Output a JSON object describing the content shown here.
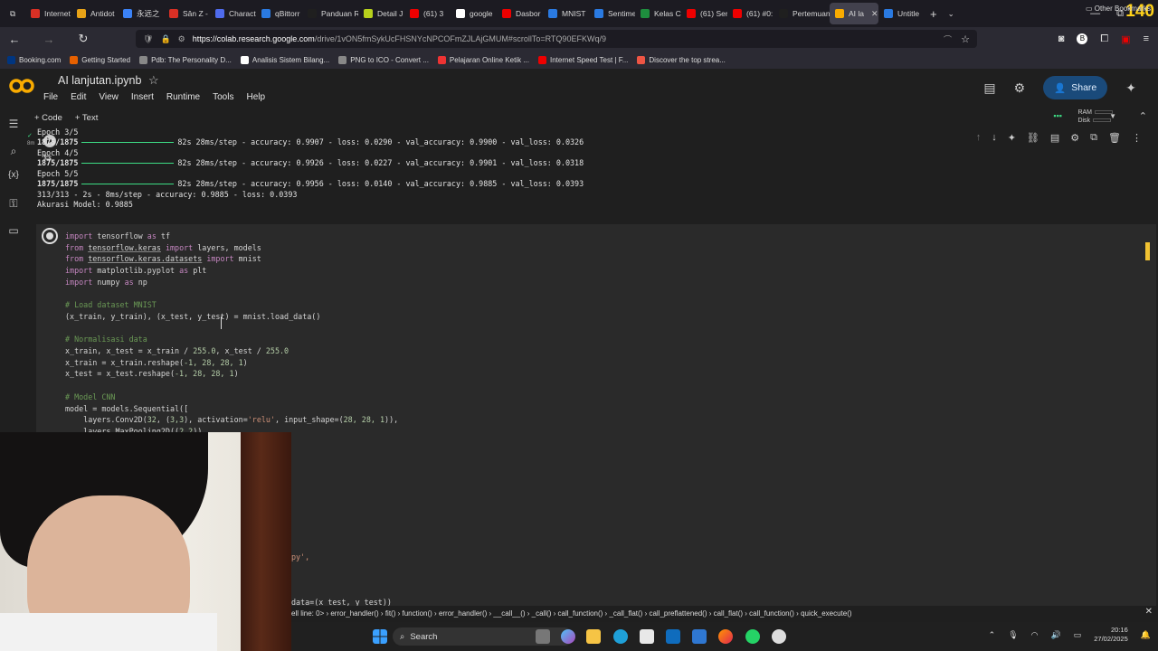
{
  "browser": {
    "tabs": [
      {
        "label": "Internet",
        "color": "#d93025"
      },
      {
        "label": "Antidot",
        "color": "#e8a317"
      },
      {
        "label": "永远之",
        "color": "#3b82f6"
      },
      {
        "label": "Sân Z -",
        "color": "#d93025"
      },
      {
        "label": "Charact",
        "color": "#4f6bed"
      },
      {
        "label": "qBittorr",
        "color": "#2a7ae2"
      },
      {
        "label": "Panduan Re",
        "color": "#1f1f1f"
      },
      {
        "label": "Detail J",
        "color": "#b7d11c"
      },
      {
        "label": "(61) 3",
        "color": "#e00"
      },
      {
        "label": "google",
        "color": "#ffffff"
      },
      {
        "label": "Dasbor",
        "color": "#e00"
      },
      {
        "label": "MNIST",
        "color": "#2a7ae2"
      },
      {
        "label": "Sentime",
        "color": "#2a7ae2"
      },
      {
        "label": "Kelas C",
        "color": "#1e8e3e"
      },
      {
        "label": "(61) Ser",
        "color": "#e00"
      },
      {
        "label": "(61) #0:",
        "color": "#e00"
      },
      {
        "label": "Pertemuan",
        "color": "#1f1f1f"
      },
      {
        "label": "AI la",
        "color": "#f9ab00",
        "active": true
      },
      {
        "label": "Untitle",
        "color": "#2a7ae2"
      }
    ],
    "overlay_number": "140",
    "url_host": "https://colab.research.google.com",
    "url_path": "/drive/1vON5fmSykUcFHSNYcNPCOFmZJLAjGMUM#scrollTo=RTQ90EFKWq/9",
    "bookmarks": [
      {
        "label": "Booking.com",
        "color": "#003580"
      },
      {
        "label": "Getting Started",
        "color": "#e66000"
      },
      {
        "label": "Pdb: The Personality D...",
        "color": "#888"
      },
      {
        "label": "Analisis Sistem Bilang...",
        "color": "#fff"
      },
      {
        "label": "PNG to ICO - Convert ...",
        "color": "#888"
      },
      {
        "label": "Pelajaran Online Ketik ...",
        "color": "#e33"
      },
      {
        "label": "Internet Speed Test | F...",
        "color": "#e00"
      },
      {
        "label": "Discover the top strea...",
        "color": "#e54"
      }
    ],
    "other_bookmarks": "Other Bookmarks"
  },
  "colab": {
    "title": "AI lanjutan.ipynb",
    "menus": [
      "File",
      "Edit",
      "View",
      "Insert",
      "Runtime",
      "Tools",
      "Help"
    ],
    "share_label": "Share",
    "add_code": "+ Code",
    "add_text": "+ Text",
    "ram_label": "RAM",
    "disk_label": "Disk",
    "exec_time": "8m"
  },
  "output": {
    "lines": [
      {
        "type": "plain",
        "text": "Epoch 3/5"
      },
      {
        "type": "progress",
        "steps": "1875/1875",
        "stats": "82s 28ms/step - accuracy: 0.9907 - loss: 0.0290 - val_accuracy: 0.9900 - val_loss: 0.0326"
      },
      {
        "type": "plain",
        "text": "Epoch 4/5"
      },
      {
        "type": "progress",
        "steps": "1875/1875",
        "stats": "82s 28ms/step - accuracy: 0.9926 - loss: 0.0227 - val_accuracy: 0.9901 - val_loss: 0.0318"
      },
      {
        "type": "plain",
        "text": "Epoch 5/5"
      },
      {
        "type": "progress",
        "steps": "1875/1875",
        "stats": "82s 28ms/step - accuracy: 0.9956 - loss: 0.0140 - val_accuracy: 0.9885 - val_loss: 0.0393"
      },
      {
        "type": "plain",
        "text": "313/313 - 2s - 8ms/step - accuracy: 0.9885 - loss: 0.0393"
      },
      {
        "type": "plain",
        "text": "Akurasi Model: 0.9885"
      }
    ]
  },
  "code": {
    "l1": [
      "import",
      " tensorflow ",
      "as",
      " tf"
    ],
    "l2": [
      "from",
      "tensorflow.keras",
      "import",
      " layers, models"
    ],
    "l3": [
      "from",
      "tensorflow.keras.datasets",
      "import",
      " mnist"
    ],
    "l4": [
      "import",
      " matplotlib.pyplot ",
      "as",
      " plt"
    ],
    "l5": [
      "import",
      " numpy ",
      "as",
      " np"
    ],
    "c1": "# Load dataset MNIST",
    "l6": "(x_train, y_train), (x_test, y_test) = mnist.load_data()",
    "c2": "# Normalisasi data",
    "l7a": "x_train, x_test = x_train / ",
    "l7b": "255.0",
    "l7c": ", x_test / ",
    "l7d": "255.0",
    "l8a": "x_train = x_train.reshape(",
    "l8b": "-1, 28, 28, 1",
    "l8c": ")",
    "l9a": "x_test = x_test.reshape(",
    "l9b": "-1, 28, 28, 1",
    "l9c": ")",
    "c3": "# Model CNN",
    "l10": "model = models.Sequential([",
    "l11a": "    layers.Conv2D(",
    "l11b": "32",
    "l11c": ", (",
    "l11d": "3,3",
    "l11e": "), activation=",
    "l11f": "'relu'",
    "l11g": ", input_shape=(",
    "l11h": "28, 28, 1",
    "l11i": ")),",
    "l12a": "    layers.MaxPooling2D((",
    "l12b": "2,2",
    "l12c": ")),",
    "l13": "py',",
    "l14": "data=(x_test, y_test))"
  },
  "trace": "ell line: 0> › error_handler() › fit() › function() › error_handler() › __call__() › _call() › call_function() › _call_flat() › call_preflattened() › call_flat() › call_function() › quick_execute()",
  "taskbar": {
    "search": "Search",
    "time": "20:16",
    "date": "27/02/2025"
  }
}
